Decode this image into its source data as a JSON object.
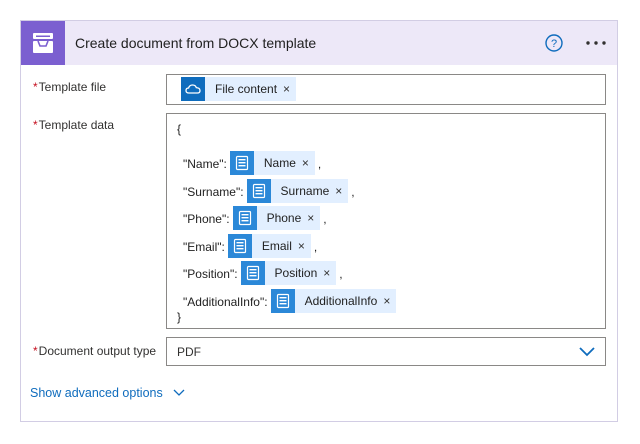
{
  "header": {
    "title": "Create document from DOCX template",
    "app_icon": "file-cabinet-icon",
    "help_icon": "help-icon",
    "more_icon": "more-icon",
    "accent": "#7b5fd0",
    "header_bg": "#ede8f8"
  },
  "fields": {
    "required_mark": "*",
    "template_file": {
      "label": "Template file",
      "token": {
        "label": "File content",
        "close": "×",
        "icon": "onedrive-icon",
        "icon_color": "#0f6cbd"
      }
    },
    "template_data": {
      "label": "Template data",
      "open_brace": "{",
      "close_brace": "}",
      "rows": [
        {
          "key": "\"Name\":",
          "token": "Name",
          "suffix": ","
        },
        {
          "key": "\"Surname\":",
          "token": "Surname",
          "suffix": ","
        },
        {
          "key": "\"Phone\":",
          "token": "Phone",
          "suffix": ","
        },
        {
          "key": "\"Email\":",
          "token": "Email",
          "suffix": ","
        },
        {
          "key": "\"Position\":",
          "token": "Position",
          "suffix": ","
        },
        {
          "key": "\"AdditionalInfo\":",
          "token": "AdditionalInfo",
          "suffix": ""
        }
      ],
      "token_icon": "form-icon",
      "token_close": "×",
      "token_icon_color": "#2b88d8"
    },
    "output_type": {
      "label": "Document output type",
      "value": "PDF",
      "chevron": "chevron-down-icon"
    }
  },
  "advanced": {
    "label": "Show advanced options",
    "chevron": "chevron-down-icon"
  }
}
